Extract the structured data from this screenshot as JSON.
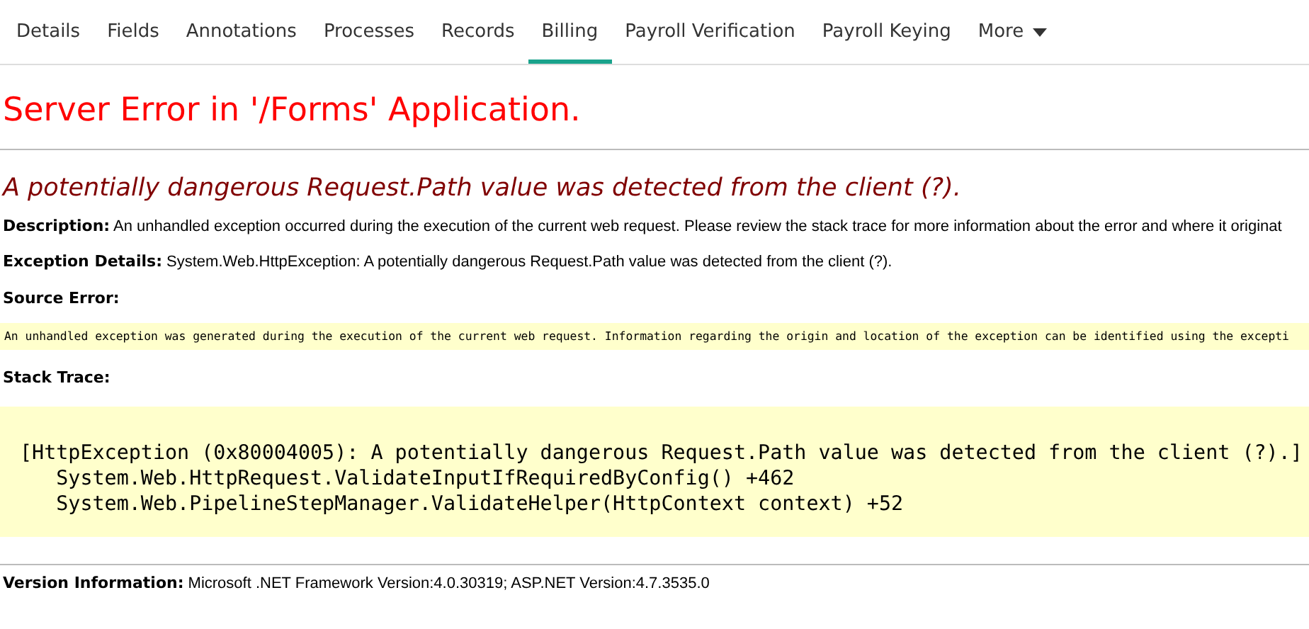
{
  "tabs": [
    {
      "label": "Details",
      "selected": false
    },
    {
      "label": "Fields",
      "selected": false
    },
    {
      "label": "Annotations",
      "selected": false
    },
    {
      "label": "Processes",
      "selected": false
    },
    {
      "label": "Records",
      "selected": false
    },
    {
      "label": "Billing",
      "selected": true
    },
    {
      "label": "Payroll Verification",
      "selected": false
    },
    {
      "label": "Payroll Keying",
      "selected": false
    },
    {
      "label": "More",
      "selected": false,
      "kind": "dropdown"
    }
  ],
  "error_page": {
    "title": "Server Error in '/Forms' Application.",
    "heading": "A potentially dangerous Request.Path value was detected from the client (?).",
    "description": {
      "label": "Description:",
      "text": "An unhandled exception occurred during the execution of the current web request. Please review the stack trace for more information about the error and where it originat"
    },
    "exception_details": {
      "label": "Exception Details:",
      "text": "System.Web.HttpException: A potentially dangerous Request.Path value was detected from the client (?)."
    },
    "source_error": {
      "label": "Source Error:",
      "text": "An unhandled exception was generated during the execution of the current web request. Information regarding the origin and location of the exception can be identified using the excepti"
    },
    "stack_trace": {
      "label": "Stack Trace:",
      "lines": [
        "[HttpException (0x80004005): A potentially dangerous Request.Path value was detected from the client (?).]",
        "   System.Web.HttpRequest.ValidateInputIfRequiredByConfig() +462",
        "   System.Web.PipelineStepManager.ValidateHelper(HttpContext context) +52"
      ]
    },
    "version_information": {
      "label": "Version Information:",
      "text": "Microsoft .NET Framework Version:4.0.30319; ASP.NET Version:4.7.3535.0"
    }
  }
}
